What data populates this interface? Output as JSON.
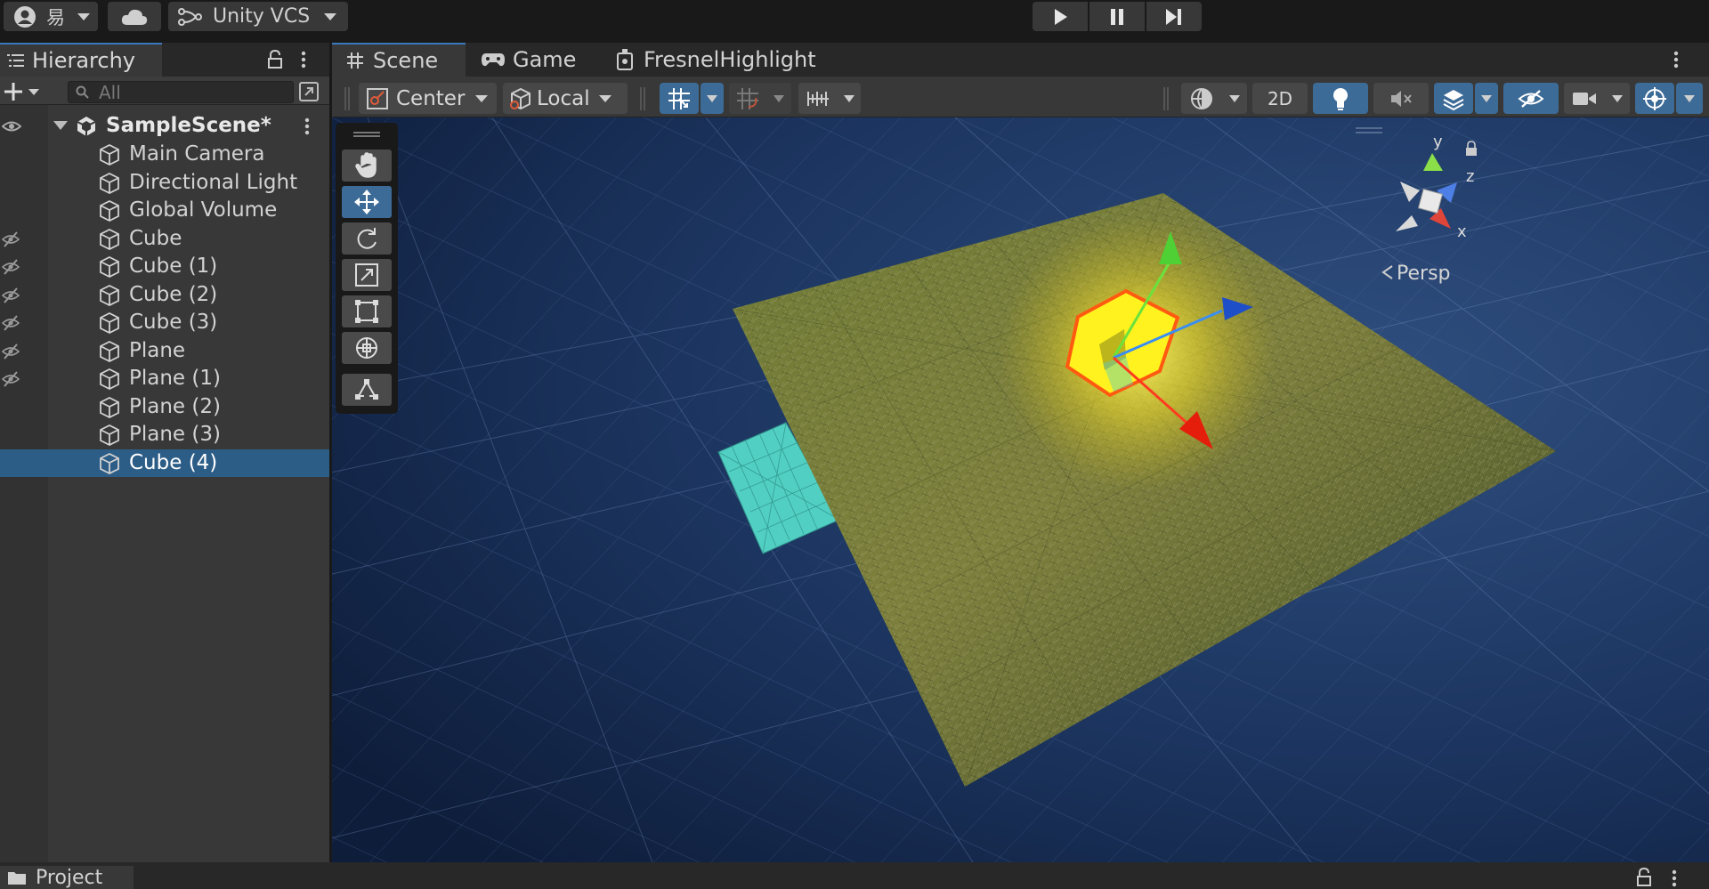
{
  "topbar": {
    "account_label": "易",
    "vcs_label": "Unity VCS"
  },
  "hierarchy": {
    "tab_label": "Hierarchy",
    "search_placeholder": "All",
    "scene_name": "SampleScene*",
    "items": [
      {
        "label": "Main Camera",
        "hidden": false,
        "selected": false
      },
      {
        "label": "Directional Light",
        "hidden": false,
        "selected": false
      },
      {
        "label": "Global Volume",
        "hidden": false,
        "selected": false
      },
      {
        "label": "Cube",
        "hidden": true,
        "selected": false
      },
      {
        "label": "Cube (1)",
        "hidden": true,
        "selected": false
      },
      {
        "label": "Cube (2)",
        "hidden": true,
        "selected": false
      },
      {
        "label": "Cube (3)",
        "hidden": true,
        "selected": false
      },
      {
        "label": "Plane",
        "hidden": true,
        "selected": false
      },
      {
        "label": "Plane (1)",
        "hidden": true,
        "selected": false
      },
      {
        "label": "Plane (2)",
        "hidden": false,
        "selected": false
      },
      {
        "label": "Plane (3)",
        "hidden": false,
        "selected": false
      },
      {
        "label": "Cube (4)",
        "hidden": false,
        "selected": true
      }
    ]
  },
  "scene_tabs": {
    "scene": "Scene",
    "game": "Game",
    "fresnel": "FresnelHighlight"
  },
  "scene_toolbar": {
    "pivot_mode": "Center",
    "pivot_rotation": "Local",
    "mode_2d": "2D"
  },
  "gizmo": {
    "y": "y",
    "z": "z",
    "x": "x",
    "projection": "Persp"
  },
  "project": {
    "tab_label": "Project"
  },
  "colors": {
    "accent_blue": "#3a79bb",
    "selection": "#2c5d87",
    "panel": "#383838",
    "highlight_yellow": "#fff21e",
    "outline_orange": "#ff5a10",
    "teal_plane": "#52cfc3"
  }
}
